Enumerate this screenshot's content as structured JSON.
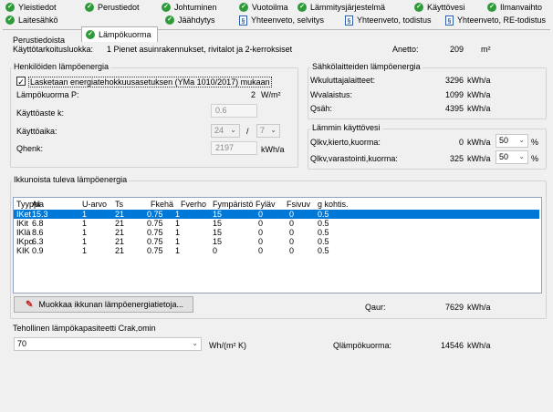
{
  "tabs_row1": [
    {
      "label": "Yleistiedot",
      "icon": "check-circle-icon"
    },
    {
      "label": "Perustiedot",
      "icon": "check-circle-icon"
    },
    {
      "label": "Johtuminen",
      "icon": "check-circle-icon"
    },
    {
      "label": "Vuotoilma",
      "icon": "check-circle-icon"
    },
    {
      "label": "Lämmitysjärjestelmä",
      "icon": "check-circle-icon"
    },
    {
      "label": "Käyttövesi",
      "icon": "check-circle-icon"
    },
    {
      "label": "Ilmanvaihto",
      "icon": "check-circle-icon"
    }
  ],
  "tabs_row2": [
    {
      "label": "Laitesähkö",
      "icon": "check-circle-icon"
    },
    {
      "label": "Lämpökuorma",
      "icon": "check-circle-icon",
      "active": true
    },
    {
      "label": "Jäähdytys",
      "icon": "check-circle-icon"
    },
    {
      "label": "Yhteenveto, selvitys",
      "icon": "document-icon"
    },
    {
      "label": "Yhteenveto, todistus",
      "icon": "document-icon"
    },
    {
      "label": "Yhteenveto, RE-todistus",
      "icon": "document-icon"
    }
  ],
  "perustiedoista": {
    "title": "Perustiedoista",
    "kayttotarkoitus_label": "Käyttötarkoitusluokka:",
    "kayttotarkoitus_value": "1 Pienet asuinrakennukset, rivitalot ja 2-kerroksiset",
    "anetto_label": "Anetto:",
    "anetto_value": "209",
    "anetto_unit": "m²"
  },
  "henkiloiden": {
    "title": "Henkilöiden lämpöenergia",
    "checkbox_label": "Lasketaan energiatehokkuusasetuksen (YMa 1010/2017) mukaan",
    "checked": true,
    "lampokuorma_label": "Lämpökuorma P:",
    "lampokuorma_value": "2",
    "lampokuorma_unit": "W/m²",
    "kayttoaste_label": "Käyttöaste k:",
    "kayttoaste_value": "0.6",
    "kayttoaika_label": "Käyttöaika:",
    "kayttoaika_h": "24",
    "kayttoaika_sep": "/",
    "kayttoaika_d": "7",
    "qhenk_label": "Qhenk:",
    "qhenk_value": "2197",
    "qhenk_unit": "kWh/a"
  },
  "sahkolaitteiden": {
    "title": "Sähkölaitteiden lämpöenergia",
    "rows": [
      {
        "label": "Wkuluttajalaitteet:",
        "value": "3296",
        "unit": "kWh/a"
      },
      {
        "label": "Wvalaistus:",
        "value": "1099",
        "unit": "kWh/a"
      },
      {
        "label": "Qsäh:",
        "value": "4395",
        "unit": "kWh/a"
      }
    ]
  },
  "lamminvesi": {
    "title": "Lämmin käyttövesi",
    "rows": [
      {
        "label": "Qlkv,kierto,kuorma:",
        "value": "0",
        "unit": "kWh/a",
        "pct": "50",
        "pct_unit": "%"
      },
      {
        "label": "Qlkv,varastointi,kuorma:",
        "value": "325",
        "unit": "kWh/a",
        "pct": "50",
        "pct_unit": "%"
      }
    ]
  },
  "ikkunoista": {
    "title": "Ikkunoista tuleva lämpöenergia",
    "columns": [
      "Tyyppi",
      "Ala",
      "U-arvo",
      "Ts",
      "Fkehä",
      "Fverho",
      "Fympäristö",
      "Fyläv",
      "Fsivuv",
      "g kohtis."
    ],
    "rows": [
      [
        "IKet",
        "15.3",
        "1",
        "21",
        "0.75",
        "1",
        "15",
        "0",
        "0",
        "0.5"
      ],
      [
        "IKit",
        "6.8",
        "1",
        "21",
        "0.75",
        "1",
        "15",
        "0",
        "0",
        "0.5"
      ],
      [
        "IKlä",
        "8.6",
        "1",
        "21",
        "0.75",
        "1",
        "15",
        "0",
        "0",
        "0.5"
      ],
      [
        "IKpo",
        "6.3",
        "1",
        "21",
        "0.75",
        "1",
        "15",
        "0",
        "0",
        "0.5"
      ],
      [
        "KIK",
        "0.9",
        "1",
        "21",
        "0.75",
        "1",
        "0",
        "0",
        "0",
        "0.5"
      ]
    ],
    "edit_button": "Muokkaa ikkunan lämpöenergiatietoja...",
    "qaur_label": "Qaur:",
    "qaur_value": "7629",
    "qaur_unit": "kWh/a"
  },
  "tehollinen": {
    "title": "Tehollinen lämpökapasiteetti Crak,omin",
    "value": "70",
    "unit": "Wh/(m² K)",
    "qlampo_label": "Qlämpökuorma:",
    "qlampo_value": "14546",
    "qlampo_unit": "kWh/a"
  }
}
